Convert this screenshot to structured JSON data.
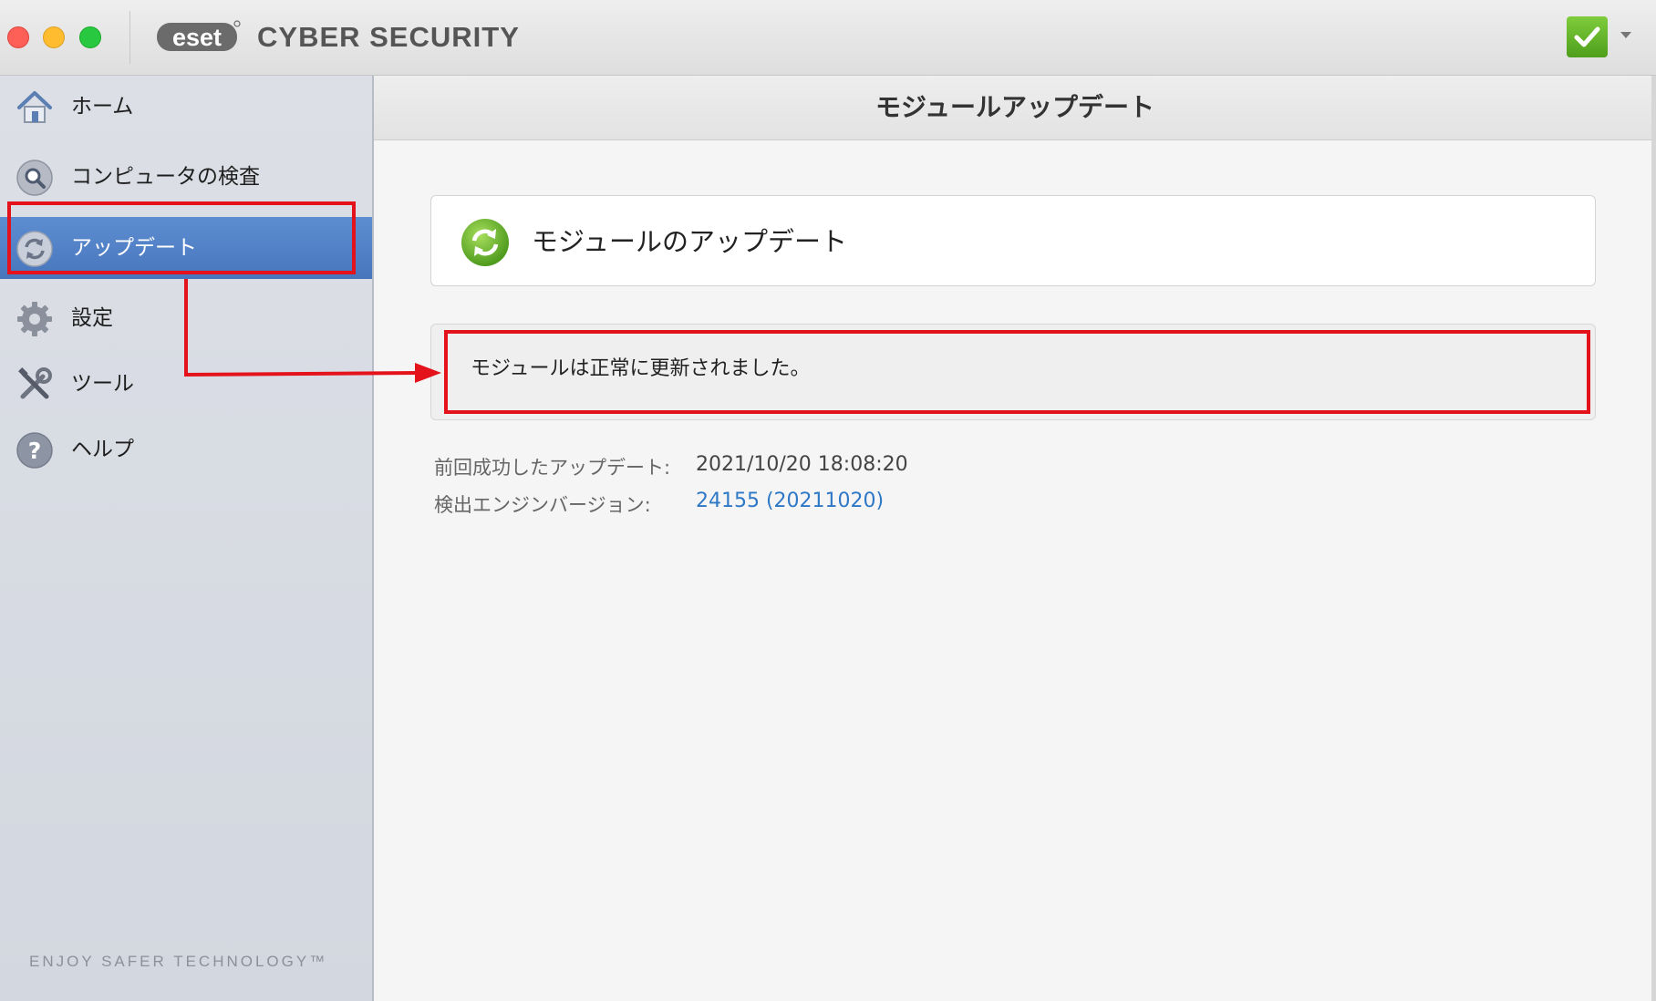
{
  "app": {
    "logo_text": "eset",
    "title": "CYBER SECURITY"
  },
  "sidebar": {
    "items": [
      {
        "label": "ホーム",
        "icon": "home-icon"
      },
      {
        "label": "コンピュータの検査",
        "icon": "magnifier-icon"
      },
      {
        "label": "アップデート",
        "icon": "update-icon",
        "active": true
      },
      {
        "label": "設定",
        "icon": "gear-icon"
      },
      {
        "label": "ツール",
        "icon": "tools-icon"
      },
      {
        "label": "ヘルプ",
        "icon": "help-icon"
      }
    ],
    "tagline": "ENJOY SAFER TECHNOLOGY™"
  },
  "main": {
    "header": "モジュールアップデート",
    "card_title": "モジュールのアップデート",
    "message": "モジュールは正常に更新されました。",
    "info": [
      {
        "label": "前回成功したアップデート:",
        "value": "2021/10/20 18:08:20"
      },
      {
        "label": "検出エンジンバージョン:",
        "value": "24155 (20211020)"
      }
    ]
  },
  "colors": {
    "active_item": "#4f7fc4",
    "annotation": "#e4121b",
    "link": "#2e78c6",
    "status_green": "#5fb22a"
  }
}
